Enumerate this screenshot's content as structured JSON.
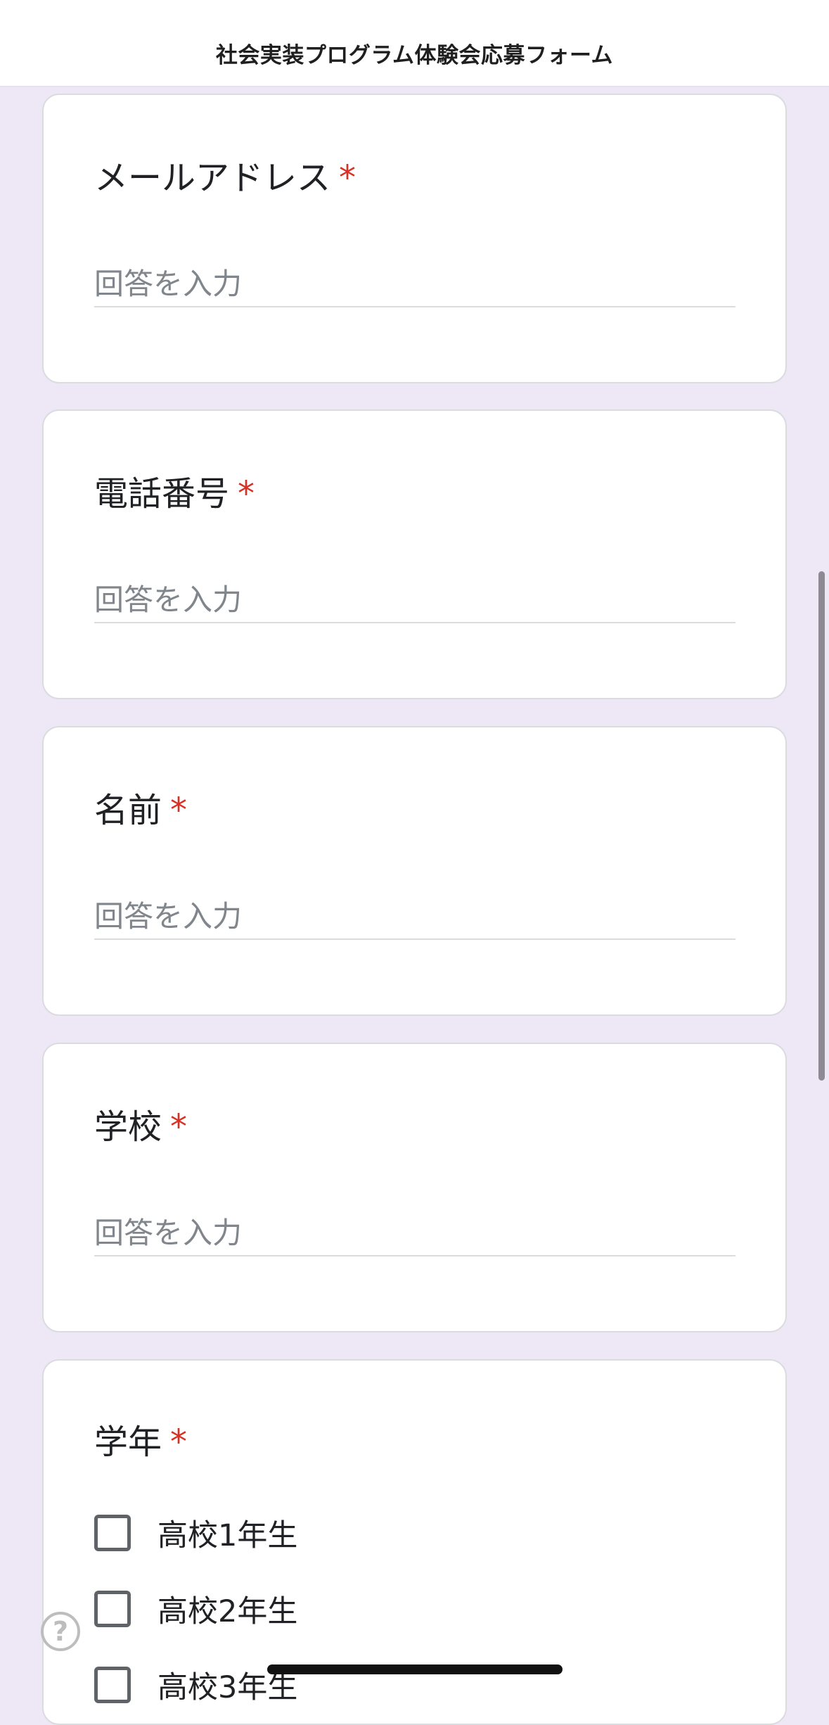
{
  "header": {
    "title": "社会実装プログラム体験会応募フォーム"
  },
  "questions": [
    {
      "label": "メールアドレス",
      "required_mark": "*",
      "placeholder": "回答を入力"
    },
    {
      "label": "電話番号",
      "required_mark": "*",
      "placeholder": "回答を入力"
    },
    {
      "label": "名前",
      "required_mark": "*",
      "placeholder": "回答を入力"
    },
    {
      "label": "学校",
      "required_mark": "*",
      "placeholder": "回答を入力"
    },
    {
      "label": "学年",
      "required_mark": "*",
      "options": [
        "高校1年生",
        "高校2年生",
        "高校3年生"
      ]
    }
  ],
  "help": {
    "icon": "help-circle-icon",
    "glyph": "?"
  },
  "colors": {
    "background": "#ede7f6",
    "required": "#d93025",
    "placeholder": "#80868b"
  }
}
